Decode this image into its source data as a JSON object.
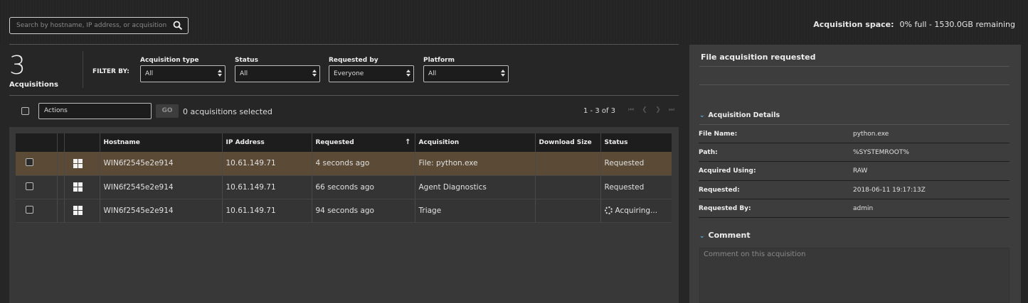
{
  "search": {
    "placeholder": "Search by hostname, IP address, or acquisition"
  },
  "acq_space": {
    "label": "Acquisition space:",
    "value": "0% full - 1530.0GB remaining"
  },
  "summary": {
    "count": "3",
    "label": "Acquisitions"
  },
  "filters": {
    "label": "FILTER BY:",
    "items": [
      {
        "label": "Acquisition type",
        "value": "All"
      },
      {
        "label": "Status",
        "value": "All"
      },
      {
        "label": "Requested by",
        "value": "Everyone"
      },
      {
        "label": "Platform",
        "value": "All"
      }
    ]
  },
  "actions": {
    "select_value": "Actions",
    "go_label": "GO",
    "selected_count": "0",
    "selected_text": "acquisitions selected"
  },
  "pager": {
    "text": "1 - 3 of 3"
  },
  "table": {
    "columns": [
      "Hostname",
      "IP Address",
      "Requested",
      "Acquisition",
      "Download Size",
      "Status"
    ],
    "sort_indicator": "↑",
    "rows": [
      {
        "hostname": "WIN6f2545e2e914",
        "ip": "10.61.149.71",
        "requested": "4 seconds ago",
        "acquisition": "File: python.exe",
        "download_size": "",
        "status": "Requested",
        "platform_icon": "windows-icon"
      },
      {
        "hostname": "WIN6f2545e2e914",
        "ip": "10.61.149.71",
        "requested": "66 seconds ago",
        "acquisition": "Agent Diagnostics",
        "download_size": "",
        "status": "Requested",
        "platform_icon": "windows-icon"
      },
      {
        "hostname": "WIN6f2545e2e914",
        "ip": "10.61.149.71",
        "requested": "94 seconds ago",
        "acquisition": "Triage",
        "download_size": "",
        "status": "Acquiring...",
        "platform_icon": "windows-icon"
      }
    ]
  },
  "panel": {
    "title": "File acquisition requested",
    "details_title": "Acquisition Details",
    "details": [
      {
        "key": "File Name:",
        "value": "python.exe"
      },
      {
        "key": "Path:",
        "value": "%SYSTEMROOT%"
      },
      {
        "key": "Acquired Using:",
        "value": "RAW"
      },
      {
        "key": "Requested:",
        "value": "2018-06-11 19:17:13Z"
      },
      {
        "key": "Requested By:",
        "value": "admin"
      }
    ],
    "comment_title": "Comment",
    "comment_placeholder": "Comment on this acquisition"
  },
  "colors": {
    "selected_row": "#5b4b36",
    "accent": "#5ab4e8",
    "background": "#262626"
  }
}
